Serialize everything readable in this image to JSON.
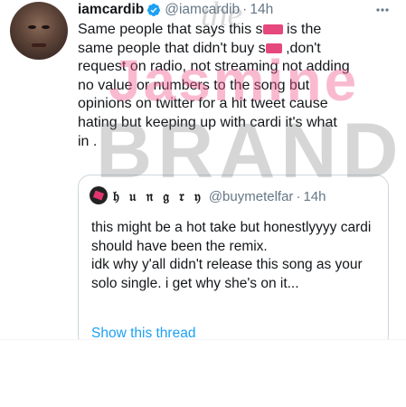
{
  "tweet": {
    "display_name": "iamcardib",
    "handle": "@iamcardib",
    "separator": "·",
    "time": "14h",
    "lines": [
      "Same people that says this s",
      " is the",
      "same people that didn't buy s",
      " ,don't",
      "request on radio, not streaming not adding",
      "no value or numbers to the song but",
      "opinions on twitter for a hit tweet cause",
      "hating but keeping up with cardi it's what",
      "in ."
    ]
  },
  "quote": {
    "display_name": "𝔥 𝔲 𝔫 𝔤 𝔯 𝔶",
    "handle": "@buymetelfar",
    "separator": "·",
    "time": "14h",
    "paragraph1": "this might be a hot take but honestlyyyy cardi should have been the remix.",
    "paragraph2": "idk why y'all didn't release this song as your solo single. i get why she's on it...",
    "show_thread": "Show this thread"
  },
  "watermark": {
    "line1": "the",
    "line2": "Jasmine",
    "line3": "BRAND"
  },
  "colors": {
    "link": "#1da1f2",
    "secondary_text": "#657786",
    "verified": "#1da1f2",
    "censor": "#e2346f"
  },
  "icons": {
    "verified": "verified-badge-icon",
    "more": "more-options-icon"
  }
}
